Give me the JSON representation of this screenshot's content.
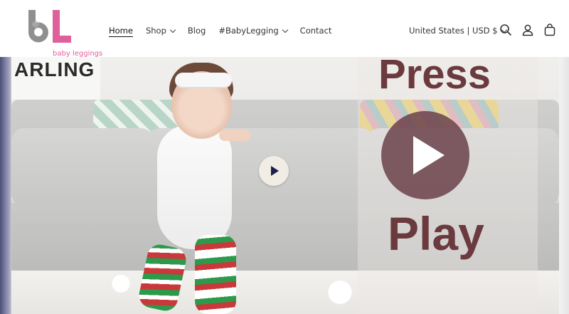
{
  "brand": {
    "logo_letters": "bL",
    "logo_text": "baby leggings",
    "colors": {
      "logo_gray": "#8f8f8f",
      "logo_pink": "#e0609b"
    }
  },
  "nav": {
    "items": [
      {
        "label": "Home",
        "active": true,
        "has_dropdown": false
      },
      {
        "label": "Shop",
        "active": false,
        "has_dropdown": true
      },
      {
        "label": "Blog",
        "active": false,
        "has_dropdown": false
      },
      {
        "label": "#BabyLegging",
        "active": false,
        "has_dropdown": true
      },
      {
        "label": "Contact",
        "active": false,
        "has_dropdown": false
      }
    ]
  },
  "header": {
    "currency_label": "United States | USD $",
    "icons": [
      "search-icon",
      "account-icon",
      "cart-icon"
    ]
  },
  "hero": {
    "sign_text": "ARLING",
    "press_text": "Press",
    "play_text": "Play",
    "colors": {
      "overlay_text": "#6b3a3f",
      "play_button": "#6e464e",
      "small_play_icon": "#1b1f4a"
    }
  }
}
